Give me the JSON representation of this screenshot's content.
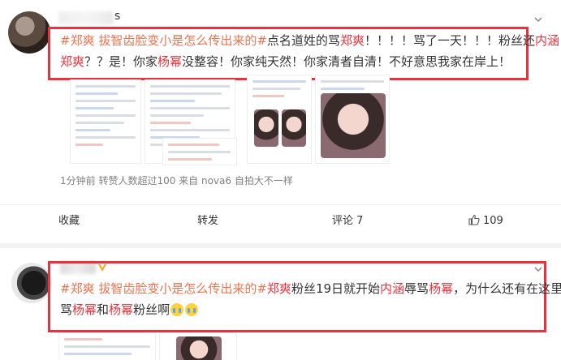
{
  "post1": {
    "username_fragment": "s",
    "text_line1": [
      {
        "t": "#郑爽 拔智齿脸变小是怎么传出来的#",
        "c": "tag"
      },
      {
        "t": "点名道姓的骂",
        "c": ""
      },
      {
        "t": "郑爽",
        "c": "red"
      },
      {
        "t": "！！！！骂了一天！！！粉丝还",
        "c": ""
      },
      {
        "t": "内涵",
        "c": "red"
      }
    ],
    "text_line2": [
      {
        "t": "郑爽",
        "c": "red"
      },
      {
        "t": "？？是！你家",
        "c": ""
      },
      {
        "t": "杨幂",
        "c": "red"
      },
      {
        "t": "没整容！你家纯天然！你家清者自清！不好意思我家在岸上！",
        "c": ""
      }
    ],
    "meta": "1分钟前 转赞人数超过100  来自 nova6 自拍大不一样",
    "actions": {
      "collect": "收藏",
      "repost": "转发",
      "comment": "评论 7",
      "like_count": "109"
    }
  },
  "post2": {
    "text_line1": [
      {
        "t": "#郑爽 拔智齿脸变小是怎么传出来的#",
        "c": "tag"
      },
      {
        "t": "郑爽",
        "c": "red"
      },
      {
        "t": "粉丝19日就开始",
        "c": ""
      },
      {
        "t": "内涵",
        "c": "red"
      },
      {
        "t": "辱骂",
        "c": ""
      },
      {
        "t": "杨幂",
        "c": "red"
      },
      {
        "t": "，为什么还有在这里",
        "c": ""
      }
    ],
    "text_line2": [
      {
        "t": "骂",
        "c": ""
      },
      {
        "t": "杨幂",
        "c": "red"
      },
      {
        "t": "和",
        "c": ""
      },
      {
        "t": "杨幂",
        "c": "red"
      },
      {
        "t": "粉丝啊",
        "c": ""
      }
    ]
  },
  "colors": {
    "highlight_border": "#e8323d",
    "topic": "#eb7350",
    "mention": "#e8323d"
  }
}
